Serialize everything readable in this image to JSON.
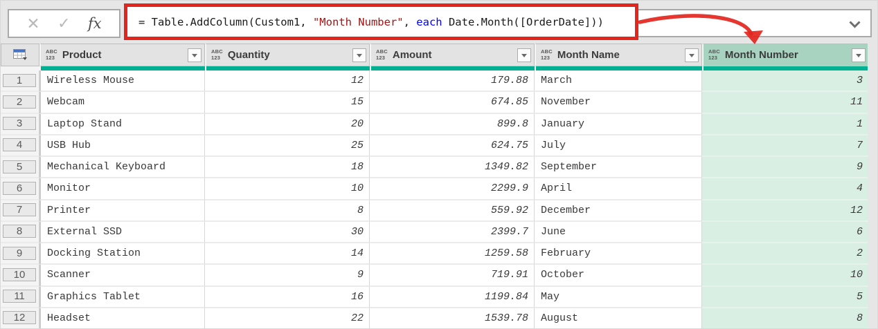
{
  "colors": {
    "accent_teal": "#00b092",
    "selected_header_green": "#a7d3c0",
    "selected_cell_green": "#d9efe4",
    "annotation_red": "#e3261d",
    "formula_string_red": "#a31515",
    "formula_keyword_blue": "#0000ff"
  },
  "formula_bar": {
    "cancel_icon": "✕",
    "check_icon": "✓",
    "function_icon": "fx",
    "chevron_icon": "chevron-down",
    "segments": {
      "prefix": "= Table.AddColumn(Custom1, ",
      "string": "\"Month Number\"",
      "mid": ", ",
      "keyword": "each",
      "suffix": " Date.Month([OrderDate]))"
    }
  },
  "table": {
    "corner_icon": "table-grid-icon",
    "columns": [
      {
        "label": "Product",
        "type_top": "ABC",
        "type_bottom": "123",
        "selected": false
      },
      {
        "label": "Quantity",
        "type_top": "ABC",
        "type_bottom": "123",
        "selected": false
      },
      {
        "label": "Amount",
        "type_top": "ABC",
        "type_bottom": "123",
        "selected": false
      },
      {
        "label": "Month Name",
        "type_top": "ABC",
        "type_bottom": "123",
        "selected": false
      },
      {
        "label": "Month Number",
        "type_top": "ABC",
        "type_bottom": "123",
        "selected": true
      }
    ],
    "rows": [
      {
        "num": "1",
        "product": "Wireless Mouse",
        "quantity": "12",
        "amount": "179.88",
        "month_name": "March",
        "month_number": "3"
      },
      {
        "num": "2",
        "product": "Webcam",
        "quantity": "15",
        "amount": "674.85",
        "month_name": "November",
        "month_number": "11"
      },
      {
        "num": "3",
        "product": "Laptop Stand",
        "quantity": "20",
        "amount": "899.8",
        "month_name": "January",
        "month_number": "1"
      },
      {
        "num": "4",
        "product": "USB Hub",
        "quantity": "25",
        "amount": "624.75",
        "month_name": "July",
        "month_number": "7"
      },
      {
        "num": "5",
        "product": "Mechanical Keyboard",
        "quantity": "18",
        "amount": "1349.82",
        "month_name": "September",
        "month_number": "9"
      },
      {
        "num": "6",
        "product": "Monitor",
        "quantity": "10",
        "amount": "2299.9",
        "month_name": "April",
        "month_number": "4"
      },
      {
        "num": "7",
        "product": "Printer",
        "quantity": "8",
        "amount": "559.92",
        "month_name": "December",
        "month_number": "12"
      },
      {
        "num": "8",
        "product": "External SSD",
        "quantity": "30",
        "amount": "2399.7",
        "month_name": "June",
        "month_number": "6"
      },
      {
        "num": "9",
        "product": "Docking Station",
        "quantity": "14",
        "amount": "1259.58",
        "month_name": "February",
        "month_number": "2"
      },
      {
        "num": "10",
        "product": "Scanner",
        "quantity": "9",
        "amount": "719.91",
        "month_name": "October",
        "month_number": "10"
      },
      {
        "num": "11",
        "product": "Graphics Tablet",
        "quantity": "16",
        "amount": "1199.84",
        "month_name": "May",
        "month_number": "5"
      },
      {
        "num": "12",
        "product": "Headset",
        "quantity": "22",
        "amount": "1539.78",
        "month_name": "August",
        "month_number": "8"
      }
    ]
  }
}
